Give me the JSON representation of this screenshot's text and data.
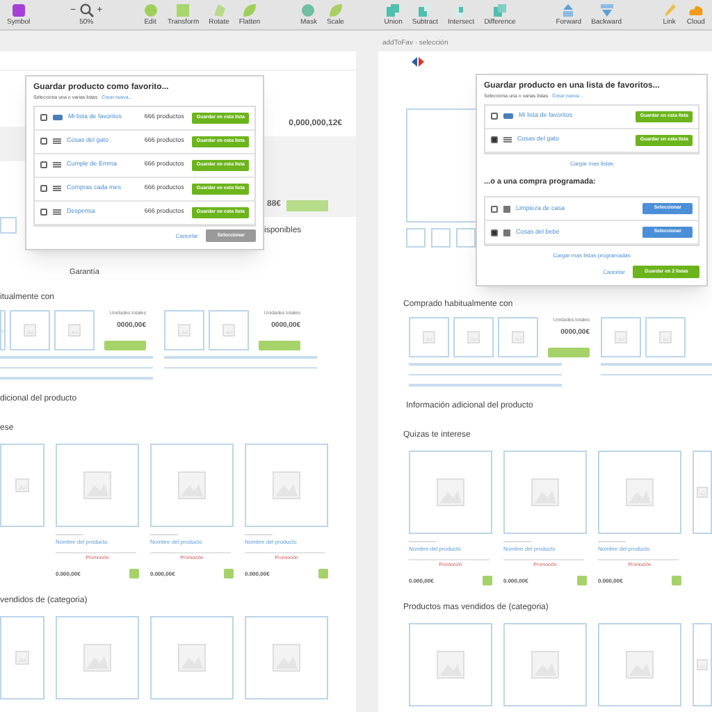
{
  "toolbar": [
    {
      "items": [
        {
          "label": "Symbol"
        }
      ]
    },
    {
      "items": [
        {
          "label": "50%",
          "minus": "−",
          "plus": "+"
        }
      ]
    },
    {
      "items": [
        {
          "label": "Edit"
        },
        {
          "label": "Transform"
        },
        {
          "label": "Rotate"
        },
        {
          "label": "Flatten"
        }
      ]
    },
    {
      "items": [
        {
          "label": "Mask"
        },
        {
          "label": "Scale"
        }
      ]
    },
    {
      "items": [
        {
          "label": "Union"
        },
        {
          "label": "Subtract"
        },
        {
          "label": "Intersect"
        },
        {
          "label": "Difference"
        }
      ]
    },
    {
      "items": [
        {
          "label": "Forward"
        },
        {
          "label": "Backward"
        }
      ]
    },
    {
      "items": [
        {
          "label": "Link"
        },
        {
          "label": "Cloud"
        }
      ]
    }
  ],
  "left_artboard": {
    "background": {
      "price": "0,000,000,12€",
      "panel_price": "88€",
      "availability": "isponibles",
      "warranty": "Garantía"
    },
    "modal": {
      "title": "Guardar producto como favorito...",
      "subtitle": "Selecciona una o varias listas",
      "create_link": "Crear nueva...",
      "rows": [
        {
          "kind": "favorites",
          "name": "Mi lista de favoritos",
          "checked": false,
          "count": "666 productos",
          "button": "Guardar en esta lista"
        },
        {
          "kind": "list",
          "name": "Cosas del gato",
          "checked": false,
          "count": "666 productos",
          "button": "Guardar en esta lista"
        },
        {
          "kind": "list",
          "name": "Cumple de Emma",
          "checked": false,
          "count": "666 productos",
          "button": "Guardar en esta lista"
        },
        {
          "kind": "list",
          "name": "Compras cada mes",
          "checked": false,
          "count": "666 productos",
          "button": "Guardar en esta lista"
        },
        {
          "kind": "list",
          "name": "Despensa",
          "checked": false,
          "count": "666 productos",
          "button": "Guardar en esta lista"
        }
      ],
      "cancel": "Cancelar",
      "confirm": {
        "label": "Seleccionar",
        "disabled": true
      }
    },
    "bought_with": {
      "heading": "itualmente con",
      "groups": [
        {
          "label": "Unidades totales",
          "price": "0000,00€"
        },
        {
          "label": "Unidades totales",
          "price": "0000,00€"
        }
      ]
    },
    "extra_info": "dicional del producto",
    "recommended": {
      "heading": "ese",
      "cards": [
        {
          "name": "Nombre del producto",
          "promo": "Promoción",
          "price": "0.000,00€"
        },
        {
          "name": "Nombre del producto",
          "promo": "Promoción",
          "price": "0.000,00€"
        },
        {
          "name": "Nombre del producto",
          "promo": "Promoción",
          "price": "0.000,00€"
        }
      ]
    },
    "bestsellers": {
      "heading": "vendidos de (categoria)"
    }
  },
  "right_artboard": {
    "title": "addToFav · selección",
    "modal": {
      "title": "Guardar producto en una lista de favoritos...",
      "subtitle": "Selecciona una o varias listas",
      "create_link": "Crear nueva...",
      "rows": [
        {
          "kind": "favorites",
          "name": "Mi lista de favoritos",
          "checked": false,
          "button": "Guardar en esta lista"
        },
        {
          "kind": "list",
          "name": "Cosas del gato",
          "checked": true,
          "button": "Guardar en esta lista"
        }
      ],
      "more_lists": "Cargar mas listas",
      "scheduled_heading": "...o a una compra programada:",
      "scheduled": [
        {
          "name": "Limpieza de casa",
          "checked": false,
          "button": "Seleccionar"
        },
        {
          "name": "Cosas del bebé",
          "checked": true,
          "button": "Seleccionar"
        }
      ],
      "more_scheduled": "Cargar mas listas programadas",
      "cancel": "Cancelar",
      "confirm": {
        "label": "Guardar en 2 listas",
        "disabled": false
      }
    },
    "bought_with": {
      "heading": "Comprado habitualmente con",
      "groups": [
        {
          "label": "Unidades totales",
          "price": "0000,00€"
        }
      ]
    },
    "extra_info": "Información adicional del producto",
    "recommended": {
      "heading": "Quizas te interese",
      "cards": [
        {
          "name": "Nombre del producto",
          "promo": "Promoción",
          "price": "0.000,00€"
        },
        {
          "name": "Nombre del producto",
          "promo": "Promoción",
          "price": "0.000,00€"
        },
        {
          "name": "Nombre del producto",
          "promo": "Promoción",
          "price": "0.000,00€"
        }
      ]
    },
    "bestsellers": {
      "heading": "Productos mas vendidos de (categoria)"
    }
  }
}
